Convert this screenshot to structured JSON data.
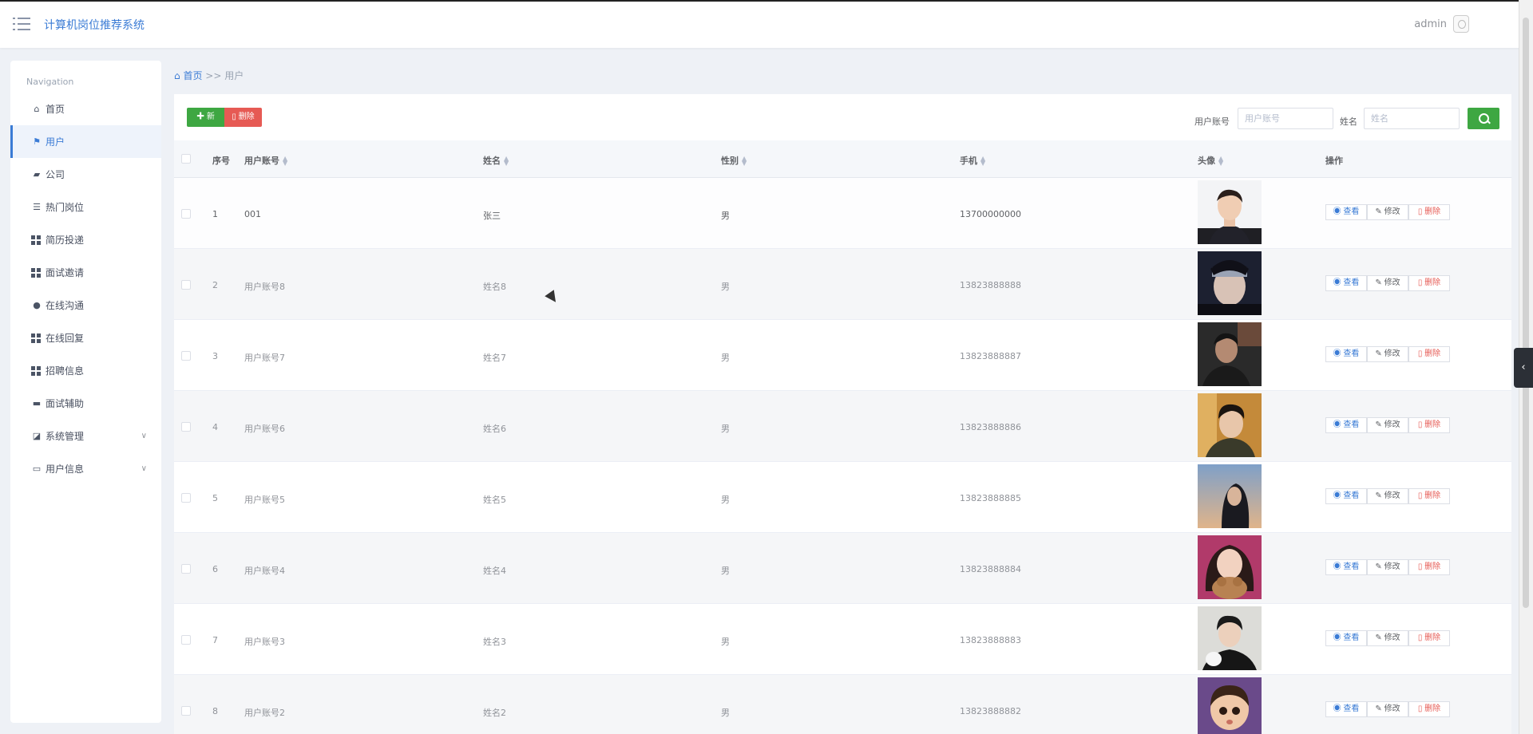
{
  "app": {
    "title": "计算机岗位推荐系统",
    "user": "admin"
  },
  "sidebar": {
    "title": "Navigation",
    "items": [
      {
        "label": "首页",
        "icon": "home-icon"
      },
      {
        "label": "用户",
        "icon": "flag-icon"
      },
      {
        "label": "公司",
        "icon": "briefcase-icon"
      },
      {
        "label": "热门岗位",
        "icon": "list-icon"
      },
      {
        "label": "简历投递",
        "icon": "grid-icon"
      },
      {
        "label": "面试邀请",
        "icon": "grid-icon"
      },
      {
        "label": "在线沟通",
        "icon": "map-pin-icon"
      },
      {
        "label": "在线回复",
        "icon": "grid-icon"
      },
      {
        "label": "招聘信息",
        "icon": "grid-icon"
      },
      {
        "label": "面试辅助",
        "icon": "chat-icon"
      },
      {
        "label": "系统管理",
        "icon": "chart-icon"
      },
      {
        "label": "用户信息",
        "icon": "card-icon"
      }
    ]
  },
  "breadcrumb": {
    "home": "首页",
    "sep": ">>",
    "current": "用户"
  },
  "toolbar": {
    "add_label": "新增",
    "delete_label": "删除",
    "account_label": "用户账号",
    "account_placeholder": "用户账号",
    "name_label": "姓名",
    "name_placeholder": "姓名"
  },
  "table": {
    "headers": {
      "index": "序号",
      "account": "用户账号",
      "name": "姓名",
      "gender": "性别",
      "phone": "手机",
      "avatar": "头像",
      "actions": "操作"
    },
    "actions": {
      "view": "查看",
      "edit": "修改",
      "delete": "删除"
    },
    "rows": [
      {
        "index": "1",
        "account": "001",
        "name": "张三",
        "gender": "男",
        "phone": "13700000000"
      },
      {
        "index": "2",
        "account": "用户账号8",
        "name": "姓名8",
        "gender": "男",
        "phone": "13823888888"
      },
      {
        "index": "3",
        "account": "用户账号7",
        "name": "姓名7",
        "gender": "男",
        "phone": "13823888887"
      },
      {
        "index": "4",
        "account": "用户账号6",
        "name": "姓名6",
        "gender": "男",
        "phone": "13823888886"
      },
      {
        "index": "5",
        "account": "用户账号5",
        "name": "姓名5",
        "gender": "男",
        "phone": "13823888885"
      },
      {
        "index": "6",
        "account": "用户账号4",
        "name": "姓名4",
        "gender": "男",
        "phone": "13823888884"
      },
      {
        "index": "7",
        "account": "用户账号3",
        "name": "姓名3",
        "gender": "男",
        "phone": "13823888883"
      },
      {
        "index": "8",
        "account": "用户账号2",
        "name": "姓名2",
        "gender": "男",
        "phone": "13823888882"
      }
    ]
  }
}
